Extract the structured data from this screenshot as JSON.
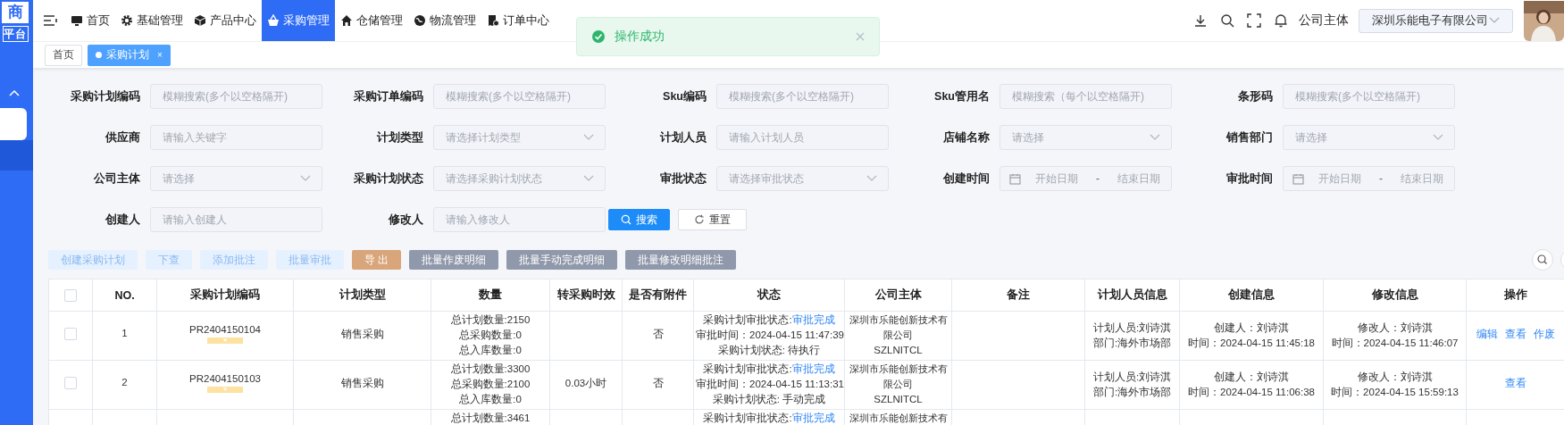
{
  "sidebar": {
    "logo": [
      "商",
      "平台"
    ],
    "group_expanded": true,
    "items": [
      {
        "selected": true
      },
      {
        "selected": false
      }
    ]
  },
  "nav": {
    "items": [
      {
        "label": "首页",
        "selected": false
      },
      {
        "label": "基础管理",
        "selected": false
      },
      {
        "label": "产品中心",
        "selected": false
      },
      {
        "label": "采购管理",
        "selected": true
      },
      {
        "label": "仓储管理",
        "selected": false
      },
      {
        "label": "物流管理",
        "selected": false
      },
      {
        "label": "订单中心",
        "selected": false
      }
    ]
  },
  "toast": {
    "kind": "success",
    "message": "操作成功"
  },
  "header_right": {
    "company_label": "公司主体",
    "company": "深圳乐能电子有限公司"
  },
  "tabs": [
    {
      "label": "首页",
      "selected": false
    },
    {
      "label": "采购计划",
      "selected": true,
      "close": "×"
    }
  ],
  "filters": [
    {
      "label": "采购计划编码",
      "kind": "text",
      "placeholder": "模糊搜索(多个以空格隔开)"
    },
    {
      "label": "采购订单编码",
      "kind": "text",
      "placeholder": "模糊搜索(多个以空格隔开)"
    },
    {
      "label": "Sku编码",
      "kind": "text",
      "placeholder": "模糊搜索(多个以空格隔开)"
    },
    {
      "label": "Sku管用名",
      "kind": "text",
      "placeholder": "模糊搜索（每个以空格隔开)"
    },
    {
      "label": "条形码",
      "kind": "text",
      "placeholder": "模糊搜索(多个以空格隔开)"
    },
    {
      "label": "供应商",
      "kind": "text",
      "placeholder": "请输入关键字"
    },
    {
      "label": "计划类型",
      "kind": "select",
      "placeholder": "请选择计划类型"
    },
    {
      "label": "计划人员",
      "kind": "text",
      "placeholder": "请输入计划人员"
    },
    {
      "label": "店铺名称",
      "kind": "select",
      "placeholder": "请选择"
    },
    {
      "label": "销售部门",
      "kind": "select",
      "placeholder": "请选择"
    },
    {
      "label": "公司主体",
      "kind": "select",
      "placeholder": "请选择"
    },
    {
      "label": "采购计划状态",
      "kind": "select",
      "placeholder": "请选择采购计划状态"
    },
    {
      "label": "审批状态",
      "kind": "select",
      "placeholder": "请选择审批状态"
    },
    {
      "label": "创建时间",
      "kind": "daterange",
      "start": "开始日期",
      "separator": "-",
      "end": "结束日期"
    },
    {
      "label": "审批时间",
      "kind": "daterange",
      "start": "开始日期",
      "separator": "-",
      "end": "结束日期"
    },
    {
      "label": "创建人",
      "kind": "text",
      "placeholder": "请输入创建人"
    },
    {
      "label": "修改人",
      "kind": "text",
      "placeholder": "请输入修改人"
    }
  ],
  "filter_actions": [
    {
      "label": "搜索",
      "kind": "primary"
    },
    {
      "label": "重置",
      "kind": "default"
    }
  ],
  "toolbar": [
    {
      "label": "创建采购计划",
      "kind": "light"
    },
    {
      "label": "下查",
      "kind": "light"
    },
    {
      "label": "添加批注",
      "kind": "light"
    },
    {
      "label": "批量审批",
      "kind": "light"
    },
    {
      "label": "导 出",
      "kind": "export"
    },
    {
      "label": "批量作废明细",
      "kind": "gray"
    },
    {
      "label": "批量手动完成明细",
      "kind": "gray"
    },
    {
      "label": "批量修改明细批注",
      "kind": "gray"
    }
  ],
  "table": {
    "all_selected": false,
    "columns": [
      "NO.",
      "采购计划编码",
      "计划类型",
      "数量",
      "转采购时效",
      "是否有附件",
      "状态",
      "公司主体",
      "备注",
      "计划人员信息",
      "创建信息",
      "修改信息",
      "操作"
    ],
    "rows": [
      {
        "selected": false,
        "no": "1",
        "code": "PR2404150104",
        "type": "销售采购",
        "quantity": [
          "总计划数量:2150",
          "总采购数量:0",
          "总入库数量:0"
        ],
        "attachment": "否",
        "status": [
          {
            "label": "采购计划审批状态:",
            "link": "审批完成"
          },
          {
            "label": "审批时间：2024-04-15 11:47:39"
          },
          {
            "label": "采购计划状态: 待执行"
          }
        ],
        "company": "深圳市乐能创新技术有限公司",
        "company_code": "SZLNITCL",
        "planner": [
          "计划人员:刘诗淇",
          "部门:海外市场部"
        ],
        "created": [
          "创建人：刘诗淇",
          "时间：2024-04-15 11:45:18"
        ],
        "modified": [
          "修改人：刘诗淇",
          "时间：2024-04-15 11:46:07"
        ],
        "actions": [
          "编辑",
          "查看",
          "作废"
        ]
      },
      {
        "selected": false,
        "no": "2",
        "code": "PR2404150103",
        "type": "销售采购",
        "quantity": [
          "总计划数量:3300",
          "总采购数量:2100",
          "总入库数量:0"
        ],
        "conversion": "0.03小时",
        "attachment": "否",
        "status": [
          {
            "label": "采购计划审批状态:",
            "link": "审批完成"
          },
          {
            "label": "审批时间：2024-04-15 11:13:31"
          },
          {
            "label": "采购计划状态: 手动完成"
          }
        ],
        "company": "深圳市乐能创新技术有限公司",
        "company_code": "SZLNITCL",
        "planner": [
          "计划人员:刘诗淇",
          "部门:海外市场部"
        ],
        "created": [
          "创建人：刘诗淇",
          "时间：2024-04-15 11:06:38"
        ],
        "modified": [
          "修改人：刘诗淇",
          "时间：2024-04-15 15:59:13"
        ],
        "actions": [
          "查看"
        ]
      },
      {
        "quantity": [
          "总计划数量:3461"
        ],
        "status": [
          {
            "label": "采购计划审批状态:",
            "link": "审批完成"
          }
        ],
        "company": "深圳市乐能创新技术有"
      }
    ]
  }
}
